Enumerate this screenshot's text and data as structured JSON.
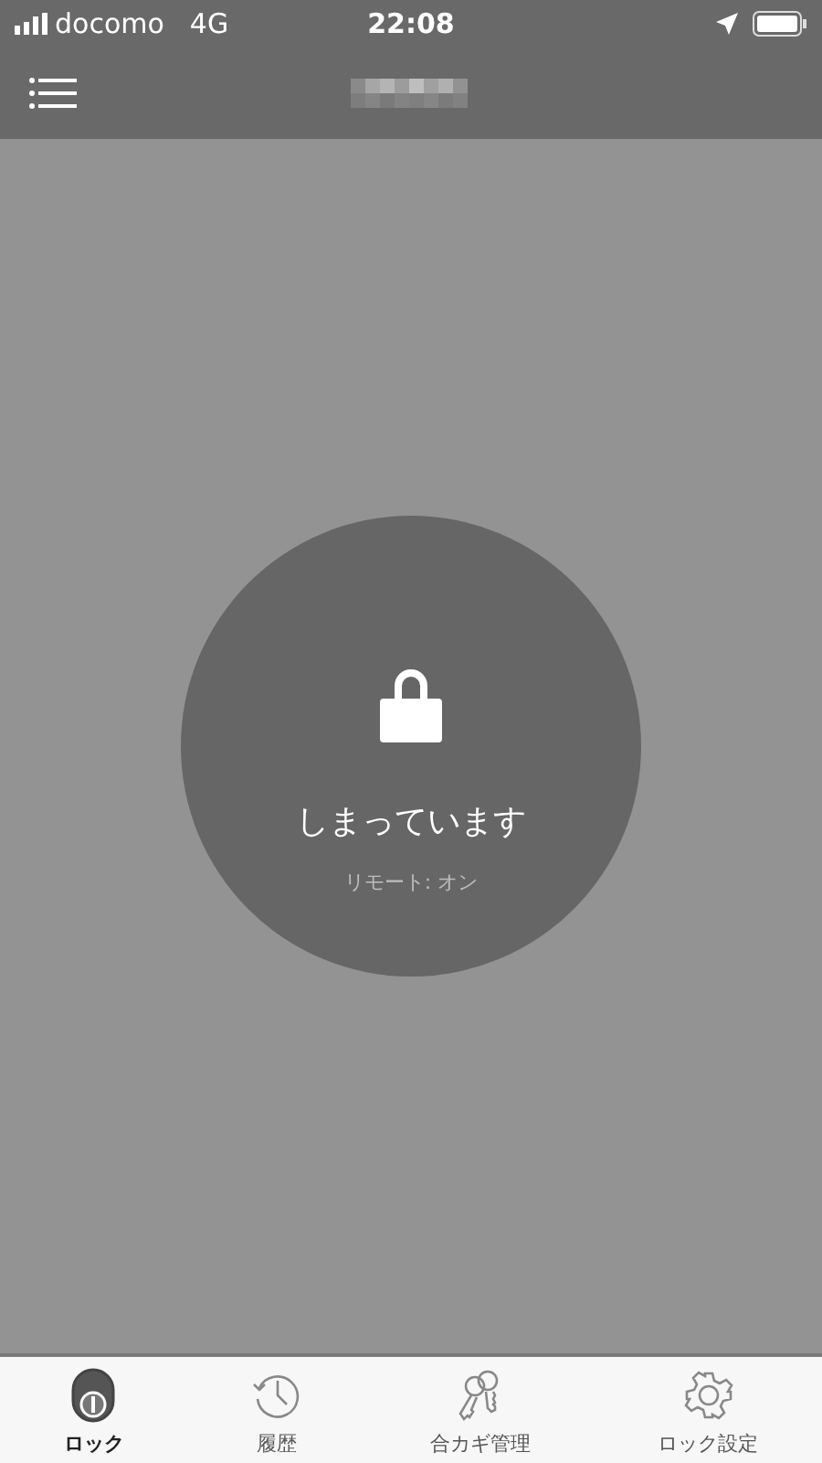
{
  "status_bar": {
    "carrier": "docomo",
    "network": "4G",
    "time": "22:08"
  },
  "lock": {
    "locked": true,
    "status": "しまっています",
    "remote": "リモート: オン"
  },
  "tabs": [
    {
      "kind": "lock",
      "label": "ロック",
      "selected": true
    },
    {
      "kind": "history",
      "label": "履歴",
      "selected": false
    },
    {
      "kind": "keys",
      "label": "合カギ管理",
      "selected": false
    },
    {
      "kind": "settings",
      "label": "ロック設定",
      "selected": false
    }
  ]
}
